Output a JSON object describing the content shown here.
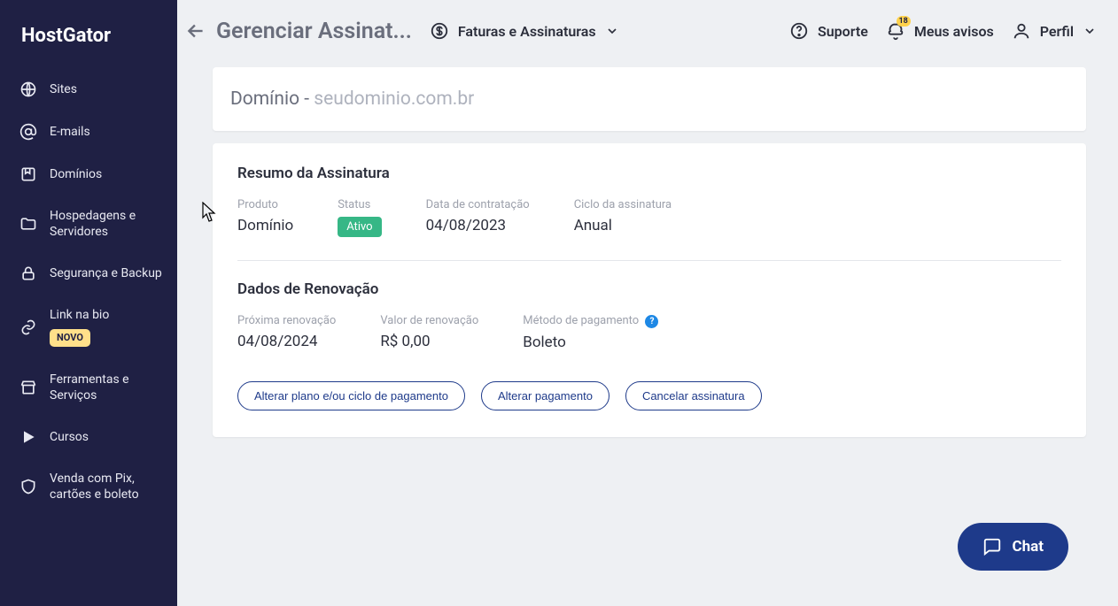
{
  "brand": "HostGator",
  "sidebar": {
    "items": [
      {
        "label": "Sites"
      },
      {
        "label": "E-mails"
      },
      {
        "label": "Domínios"
      },
      {
        "label": "Hospedagens e Servidores"
      },
      {
        "label": "Segurança e Backup"
      },
      {
        "label": "Link na bio",
        "badge": "NOVO"
      },
      {
        "label": "Ferramentas e Serviços"
      },
      {
        "label": "Cursos"
      },
      {
        "label": "Venda com Pix, cartões e boleto"
      }
    ]
  },
  "header": {
    "title": "Gerenciar Assinat...",
    "billing": "Faturas e Assinaturas",
    "support": "Suporte",
    "notices": "Meus avisos",
    "notices_count": "18",
    "profile": "Perfil"
  },
  "domain_card": {
    "prefix": "Domínio - ",
    "name": "seudominio.com.br"
  },
  "summary": {
    "title": "Resumo da Assinatura",
    "product_label": "Produto",
    "product_value": "Domínio",
    "status_label": "Status",
    "status_value": "Ativo",
    "hire_label": "Data de contratação",
    "hire_value": "04/08/2023",
    "cycle_label": "Ciclo da assinatura",
    "cycle_value": "Anual"
  },
  "renewal": {
    "title": "Dados de Renovação",
    "next_label": "Próxima renovação",
    "next_value": "04/08/2024",
    "amount_label": "Valor de renovação",
    "amount_value": "R$ 0,00",
    "method_label": "Método de pagamento",
    "method_value": "Boleto"
  },
  "actions": {
    "change_plan": "Alterar plano e/ou ciclo de pagamento",
    "change_payment": "Alterar pagamento",
    "cancel": "Cancelar assinatura"
  },
  "chat": "Chat"
}
